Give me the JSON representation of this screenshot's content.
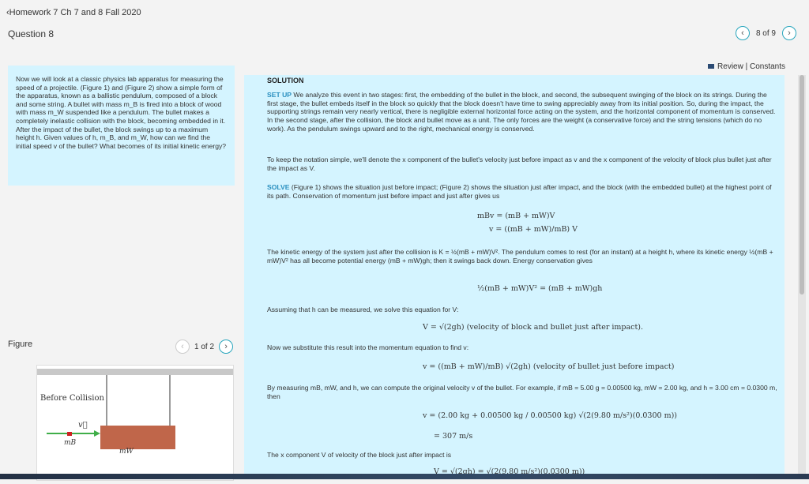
{
  "header": {
    "breadcrumb": "Homework 7 Ch 7 and 8 Fall 2020",
    "question": "Question 8",
    "pager": "8 of 9",
    "links": "Review | Constants"
  },
  "problem": {
    "text": "Now we will look at a classic physics lab apparatus for measuring the speed of a projectile. (Figure 1) and (Figure 2) show a simple form of the apparatus, known as a ballistic pendulum, composed of a block and some string. A bullet with mass m_B is fired into a block of wood with mass m_W suspended like a pendulum. The bullet makes a completely inelastic collision with the block, becoming embedded in it. After the impact of the bullet, the block swings up to a maximum height h. Given values of h, m_B, and m_W, how can we find the initial speed v of the bullet? What becomes of its initial kinetic energy?"
  },
  "figure": {
    "heading": "Figure",
    "pager": "1 of 2",
    "caption": "Before Collision",
    "v_label": "v⃗",
    "mb_label": "mB",
    "mw_label": "mW"
  },
  "solution": {
    "heading": "SOLUTION",
    "setup_tag": "SET UP",
    "setup_text": " We analyze this event in two stages: first, the embedding of the bullet in the block, and second, the subsequent swinging of the block on its strings. During the first stage, the bullet embeds itself in the block so quickly that the block doesn't have time to swing appreciably away from its initial position. So, during the impact, the supporting strings remain very nearly vertical, there is negligible external horizontal force acting on the system, and the horizontal component of momentum is conserved. In the second stage, after the collision, the block and bullet move as a unit. The only forces are the weight (a conservative force) and the string tensions (which do no work). As the pendulum swings upward and to the right, mechanical energy is conserved.",
    "notation": "To keep the notation simple, we'll denote the x component of the bullet's velocity just before impact as v and the x component of the velocity of block plus bullet just after the impact as V.",
    "solve_tag": "SOLVE",
    "solve_text": " (Figure 1) shows the situation just before impact; (Figure 2) shows the situation just after impact, and the block (with the embedded bullet) at the highest point of its path. Conservation of momentum just before impact and just after gives us",
    "eq1a": "mBv   = (mB + mW)V",
    "eq1b": "v   = ((mB + mW)/mB) V",
    "kinetic": "The kinetic energy of the system just after the collision is K = ½(mB + mW)V². The pendulum comes to rest (for an instant) at a height h, where its kinetic energy ½(mB + mW)V² has all become potential energy (mB + mW)gh; then it swings back down. Energy conservation gives",
    "eq2": "½(mB + mW)V² = (mB + mW)gh",
    "assume": "Assuming that h can be measured, we solve this equation for V:",
    "eq3": "V = √(2gh)  (velocity of block and bullet just after impact).",
    "subst": "Now we substitute this result into the momentum equation to find v:",
    "eq4": "v = ((mB + mW)/mB) √(2gh)  (velocity of bullet just before impact)",
    "measure": "By measuring mB, mW, and h, we can compute the original velocity v of the bullet. For example, if mB = 5.00 g = 0.00500 kg, mW = 2.00 kg, and h = 3.00 cm = 0.0300 m, then",
    "eq5a": "v  =  (2.00 kg + 0.00500 kg / 0.00500 kg) √(2(9.80 m/s²)(0.0300 m))",
    "eq5b": "=   307 m/s",
    "xcomp": "The x component V of velocity of the block just after impact is",
    "eq6": "V = √(2gh) = √(2(9.80 m/s²)(0.0300 m))"
  }
}
